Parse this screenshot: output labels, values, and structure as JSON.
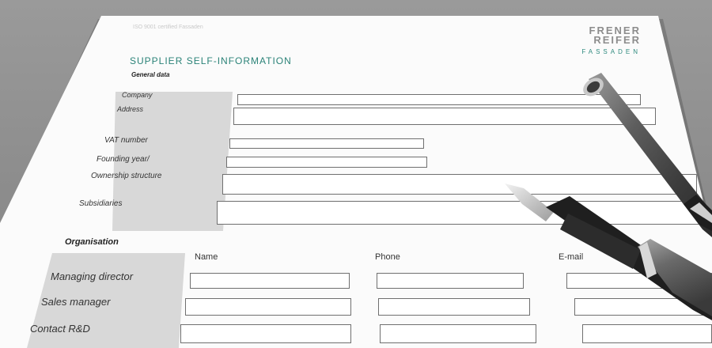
{
  "form": {
    "header_small": "ISO 9001 certified Fassaden",
    "logo": {
      "line1": "FRENER",
      "line2": "REIFER",
      "line3": "FASSADEN"
    },
    "title": "SUPPLIER SELF-INFORMATION",
    "general_section": "General data",
    "general_labels": {
      "company": "Company",
      "address": "Address",
      "vat": "VAT number",
      "founding": "Founding year/",
      "ownership": "Ownership structure",
      "subsidiaries": "Subsidiaries"
    },
    "organisation_section": "Organisation",
    "org_columns": {
      "name": "Name",
      "phone": "Phone",
      "email": "E-mail"
    },
    "org_rows": {
      "managing": "Managing director",
      "sales": "Sales manager",
      "rnd": "Contact R&D"
    }
  }
}
